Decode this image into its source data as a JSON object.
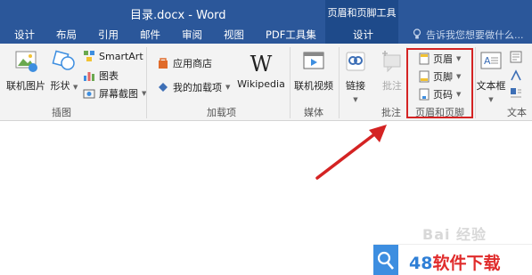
{
  "window": {
    "title": "目录.docx - Word",
    "context_tools_title": "页眉和页脚工具"
  },
  "tabs": [
    "设计",
    "布局",
    "引用",
    "邮件",
    "审阅",
    "视图",
    "PDF工具集",
    "设计"
  ],
  "tell_me": "告诉我您想要做什么...",
  "ribbon": {
    "illustrations": {
      "online_pictures": "联机图片",
      "shapes": "形状",
      "smartart": "SmartArt",
      "chart": "图表",
      "screenshot": "屏幕截图",
      "group_label": "插图"
    },
    "addins": {
      "app_store": "应用商店",
      "my_addins": "我的加载项",
      "wikipedia": "Wikipedia",
      "wikipedia_glyph": "W",
      "group_label": "加载项"
    },
    "media": {
      "online_video": "联机视频",
      "group_label": "媒体"
    },
    "links": {
      "link": "链接"
    },
    "comments": {
      "comment": "批注",
      "group_label": "批注"
    },
    "header_footer": {
      "header": "页眉",
      "footer": "页脚",
      "page_number": "页码",
      "group_label": "页眉和页脚"
    },
    "text": {
      "textbox": "文本框",
      "group_label": "文本"
    }
  },
  "watermark": {
    "baidu": "Bai 经验",
    "logo_number": "48",
    "logo_text": "软件下载"
  },
  "colors": {
    "titlebar": "#2b579a",
    "context": "#1e4a8a",
    "highlight": "#d42323",
    "arrow": "#d42323"
  }
}
